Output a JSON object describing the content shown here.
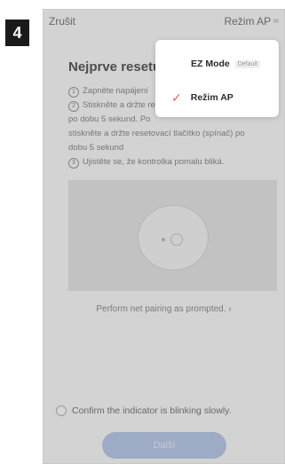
{
  "step_badge": "4",
  "topbar": {
    "cancel_label": "Zrušit",
    "mode_label": "Režim AP",
    "mode_chevron": "="
  },
  "title": "Nejprve resetu",
  "steps": [
    {
      "num": "1",
      "text": "Zapněte napájení"
    },
    {
      "num": "2",
      "text": "Stiskněte a držte re"
    },
    {
      "num": "",
      "text": "po dobu 5 sekund. Po"
    },
    {
      "num": "",
      "text": "stiskněte a držte resetovací tlačítko (spínač) po"
    },
    {
      "num": "",
      "text": "dobu 5 sekund"
    },
    {
      "num": "3",
      "text": "Ujistěte se, že kontrolka pomalu bliká."
    }
  ],
  "pairing_link": "Perform net pairing as prompted. ›",
  "confirm_text": "Confirm the indicator is blinking slowly.",
  "next_button": "Další",
  "dropdown": {
    "items": [
      {
        "label": "EZ Mode",
        "badge": "Default",
        "selected": false
      },
      {
        "label": "Režim AP",
        "badge": "",
        "selected": true
      }
    ]
  },
  "colors": {
    "accent_check": "#e8644d",
    "button_disabled": "#b9c8e6"
  },
  "icons": {
    "check": "check-icon",
    "chevron": "chevron-icon"
  }
}
